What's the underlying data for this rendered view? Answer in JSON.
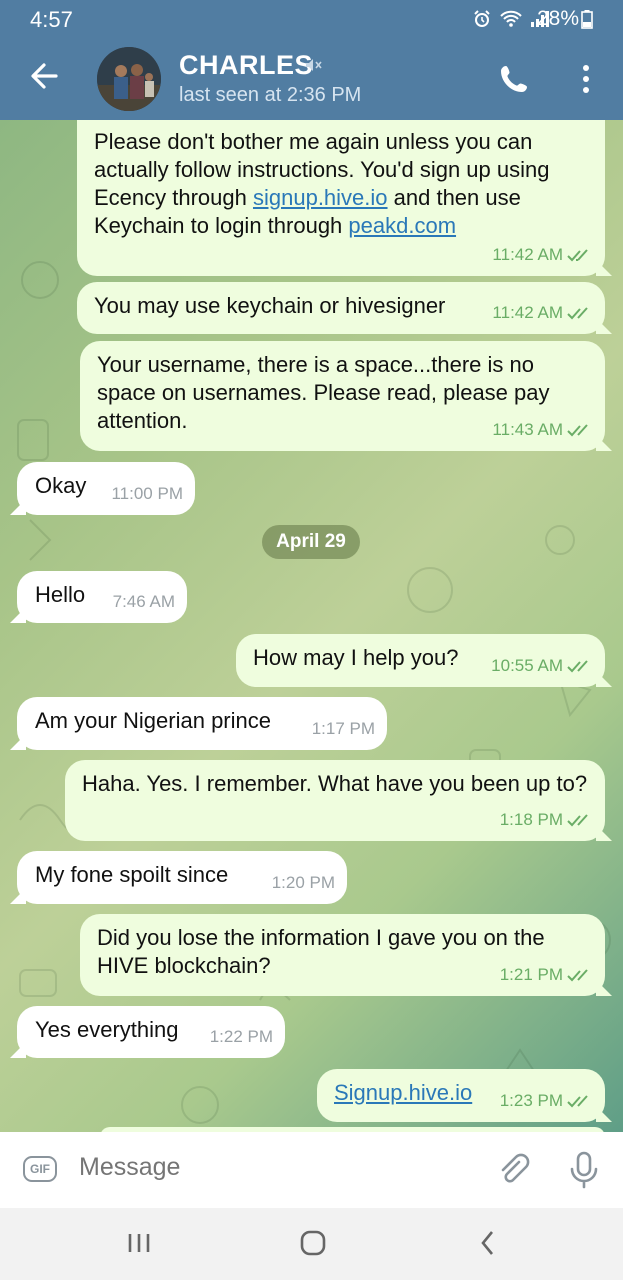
{
  "status_bar": {
    "time": "4:57",
    "battery": "28%"
  },
  "header": {
    "name": "CHARLES",
    "last_seen": "last seen at 2:36 PM"
  },
  "messages": [
    {
      "dir": "out",
      "text_before_link1": "Please don't bother me again unless you can actually follow instructions. You'd sign up using Ecency through ",
      "link1": "signup.hive.io",
      "text_middle": " and then use Keychain to login through ",
      "link2": "peakd.com",
      "time": "11:42 AM"
    },
    {
      "dir": "out",
      "text": "You may use keychain or hivesigner",
      "time": "11:42 AM"
    },
    {
      "dir": "out",
      "text": "Your username, there is a space...there is no space on usernames. Please read, please pay attention.",
      "time": "11:43 AM"
    },
    {
      "dir": "in",
      "text": "Okay",
      "time": "11:00 PM"
    },
    {
      "dir": "in",
      "text": "Hello",
      "time": "7:46 AM"
    },
    {
      "dir": "out",
      "text": "How may I help you?",
      "time": "10:55 AM"
    },
    {
      "dir": "in",
      "text": "Am your Nigerian prince",
      "time": "1:17 PM"
    },
    {
      "dir": "out",
      "text": "Haha. Yes. I remember. What have you been up to?",
      "time": "1:18 PM"
    },
    {
      "dir": "in",
      "text": "My fone spoilt since",
      "time": "1:20 PM"
    },
    {
      "dir": "out",
      "text": "Did you lose the information I gave you on the HIVE blockchain?",
      "time": "1:21 PM"
    },
    {
      "dir": "in",
      "text": "Yes everything",
      "time": "1:22 PM"
    },
    {
      "dir": "out",
      "link": "Signup.hive.io",
      "time": "1:23 PM"
    }
  ],
  "date_separator": "April 29",
  "composer": {
    "gif_label": "GIF",
    "placeholder": "Message"
  },
  "colors": {
    "header": "#517da2",
    "outgoing_bubble": "#effdde",
    "incoming_bubble": "#ffffff",
    "tick": "#6aad66",
    "link": "#2a78b8"
  }
}
